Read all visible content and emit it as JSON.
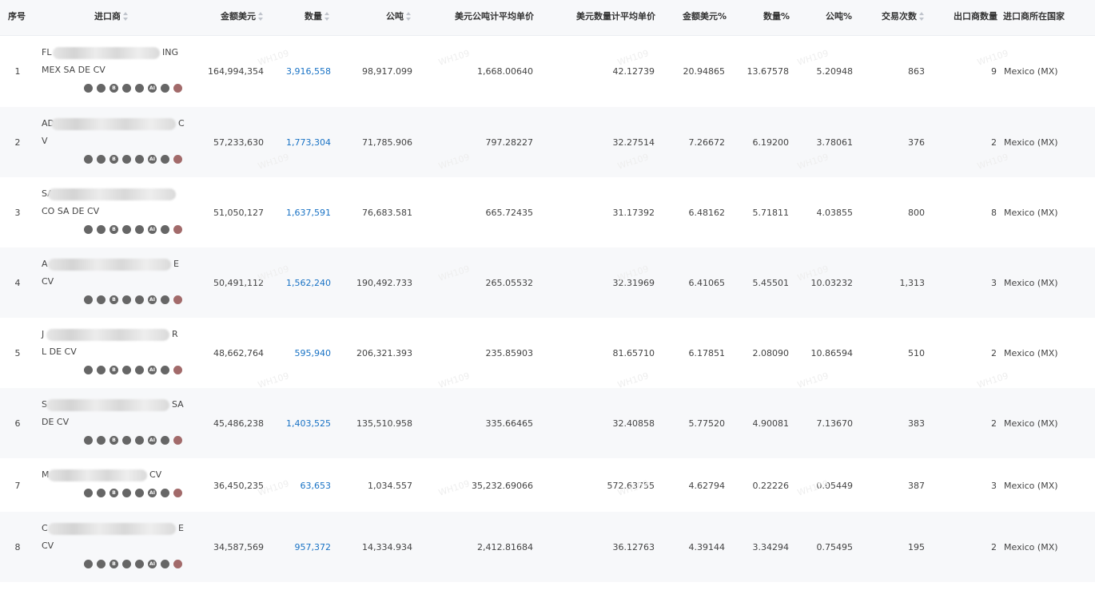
{
  "columns": {
    "idx": "序号",
    "importer": "进口商",
    "amount_usd": "金额美元",
    "quantity": "数量",
    "tons": "公吨",
    "usd_per_ton": "美元公吨计平均单价",
    "usd_per_qty": "美元数量计平均单价",
    "amount_pct": "金额美元%",
    "qty_pct": "数量%",
    "tons_pct": "公吨%",
    "trades": "交易次数",
    "exporters": "出口商数量",
    "country": "进口商所在国家"
  },
  "watermark": "WH109",
  "rows": [
    {
      "idx": "1",
      "name_l1_start": "FL",
      "name_l1_end": "ING",
      "name_l2": "MEX SA DE CV",
      "amount_usd": "164,994,354",
      "quantity": "3,916,558",
      "tons": "98,917.099",
      "usd_per_ton": "1,668.00640",
      "usd_per_qty": "42.12739",
      "amount_pct": "20.94865",
      "qty_pct": "13.67578",
      "tons_pct": "5.20948",
      "trades": "863",
      "exporters": "9",
      "country": "Mexico (MX)"
    },
    {
      "idx": "2",
      "name_l1_start": "AD",
      "name_l1_end": "C",
      "name_l2": "V",
      "amount_usd": "57,233,630",
      "quantity": "1,773,304",
      "tons": "71,785.906",
      "usd_per_ton": "797.28227",
      "usd_per_qty": "32.27514",
      "amount_pct": "7.26672",
      "qty_pct": "6.19200",
      "tons_pct": "3.78061",
      "trades": "376",
      "exporters": "2",
      "country": "Mexico (MX)"
    },
    {
      "idx": "3",
      "name_l1_start": "SA",
      "name_l1_end": "",
      "name_l2": "CO SA DE CV",
      "amount_usd": "51,050,127",
      "quantity": "1,637,591",
      "tons": "76,683.581",
      "usd_per_ton": "665.72435",
      "usd_per_qty": "31.17392",
      "amount_pct": "6.48162",
      "qty_pct": "5.71811",
      "tons_pct": "4.03855",
      "trades": "800",
      "exporters": "8",
      "country": "Mexico (MX)"
    },
    {
      "idx": "4",
      "name_l1_start": "A",
      "name_l1_end": "E",
      "name_l2": "CV",
      "amount_usd": "50,491,112",
      "quantity": "1,562,240",
      "tons": "190,492.733",
      "usd_per_ton": "265.05532",
      "usd_per_qty": "32.31969",
      "amount_pct": "6.41065",
      "qty_pct": "5.45501",
      "tons_pct": "10.03232",
      "trades": "1,313",
      "exporters": "3",
      "country": "Mexico (MX)"
    },
    {
      "idx": "5",
      "name_l1_start": "J",
      "name_l1_end": "R",
      "name_l2": "L DE CV",
      "amount_usd": "48,662,764",
      "quantity": "595,940",
      "tons": "206,321.393",
      "usd_per_ton": "235.85903",
      "usd_per_qty": "81.65710",
      "amount_pct": "6.17851",
      "qty_pct": "2.08090",
      "tons_pct": "10.86594",
      "trades": "510",
      "exporters": "2",
      "country": "Mexico (MX)"
    },
    {
      "idx": "6",
      "name_l1_start": "S",
      "name_l1_end": "SA",
      "name_l2": "DE CV",
      "amount_usd": "45,486,238",
      "quantity": "1,403,525",
      "tons": "135,510.958",
      "usd_per_ton": "335.66465",
      "usd_per_qty": "32.40858",
      "amount_pct": "5.77520",
      "qty_pct": "4.90081",
      "tons_pct": "7.13670",
      "trades": "383",
      "exporters": "2",
      "country": "Mexico (MX)"
    },
    {
      "idx": "7",
      "name_l1_start": "M",
      "name_l1_end": "CV",
      "name_l2": "",
      "amount_usd": "36,450,235",
      "quantity": "63,653",
      "tons": "1,034.557",
      "usd_per_ton": "35,232.69066",
      "usd_per_qty": "572.63755",
      "amount_pct": "4.62794",
      "qty_pct": "0.22226",
      "tons_pct": "0.05449",
      "trades": "387",
      "exporters": "3",
      "country": "Mexico (MX)"
    },
    {
      "idx": "8",
      "name_l1_start": "C",
      "name_l1_end": "E",
      "name_l2": "CV",
      "amount_usd": "34,587,569",
      "quantity": "957,372",
      "tons": "14,334.934",
      "usd_per_ton": "2,412.81684",
      "usd_per_qty": "36.12763",
      "amount_pct": "4.39144",
      "qty_pct": "3.34294",
      "tons_pct": "0.75495",
      "trades": "195",
      "exporters": "2",
      "country": "Mexico (MX)"
    }
  ],
  "row_icons": [
    "target-icon",
    "plus-circle-icon",
    "bill-of-lading-icon",
    "chat-icon",
    "globe-icon",
    "ai-icon",
    "people-icon",
    "flag-icon"
  ]
}
